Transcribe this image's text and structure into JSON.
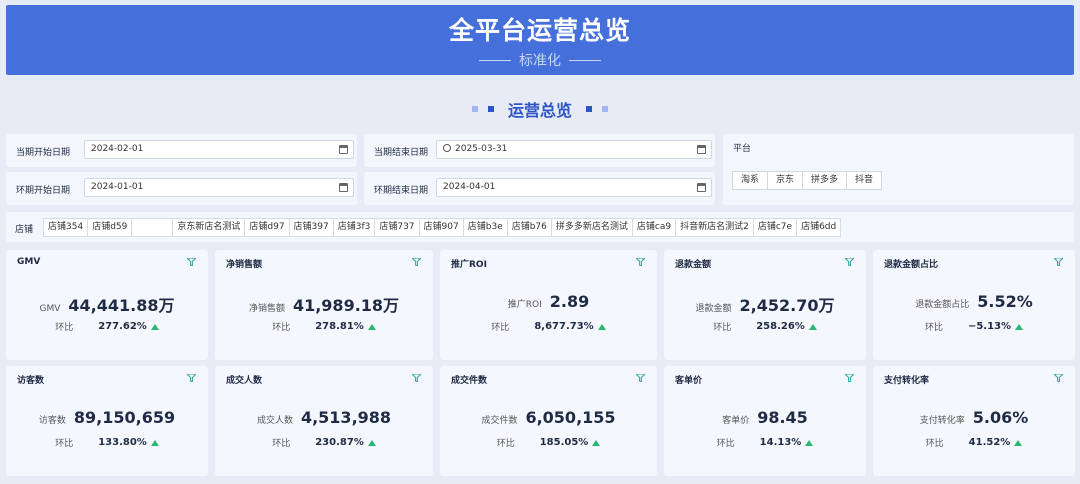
{
  "header": {
    "title": "全平台运营总览",
    "subtitle": "标准化"
  },
  "section": {
    "title": "运营总览"
  },
  "filters": {
    "cur_start_label": "当期开始日期",
    "cur_start_value": "2024-02-01",
    "cur_end_label": "当期结束日期",
    "cur_end_value": "2025-03-31",
    "prev_start_label": "环期开始日期",
    "prev_start_value": "2024-01-01",
    "prev_end_label": "环期结束日期",
    "prev_end_value": "2024-04-01",
    "platform_label": "平台",
    "platforms": [
      "淘系",
      "京东",
      "拼多多",
      "抖音"
    ]
  },
  "stores": {
    "label": "店铺",
    "items": [
      "店铺354",
      "店铺d59",
      "",
      "京东新店名测试",
      "店铺d97",
      "店铺397",
      "店铺3f3",
      "店铺737",
      "店铺907",
      "店铺b3e",
      "店铺b76",
      "拼多多新店名测试",
      "店铺ca9",
      "抖音新店名测试2",
      "店铺c7e",
      "店铺6dd"
    ]
  },
  "hb_label": "环比",
  "cards": [
    {
      "title": "GMV",
      "label": "GMV",
      "value": "44,441.88万",
      "pct": "277.62%"
    },
    {
      "title": "净销售额",
      "label": "净销售额",
      "value": "41,989.18万",
      "pct": "278.81%"
    },
    {
      "title": "推广ROI",
      "label": "推广ROI",
      "value": "2.89",
      "pct": "8,677.73%"
    },
    {
      "title": "退款金额",
      "label": "退款金额",
      "value": "2,452.70万",
      "pct": "258.26%"
    },
    {
      "title": "退款金额占比",
      "label": "退款金额占比",
      "value": "5.52%",
      "pct": "−5.13%"
    },
    {
      "title": "访客数",
      "label": "访客数",
      "value": "89,150,659",
      "pct": "133.80%"
    },
    {
      "title": "成交人数",
      "label": "成交人数",
      "value": "4,513,988",
      "pct": "230.87%"
    },
    {
      "title": "成交件数",
      "label": "成交件数",
      "value": "6,050,155",
      "pct": "185.05%"
    },
    {
      "title": "客单价",
      "label": "客单价",
      "value": "98.45",
      "pct": "14.13%"
    },
    {
      "title": "支付转化率",
      "label": "支付转化率",
      "value": "5.06%",
      "pct": "41.52%"
    }
  ],
  "colors": {
    "header_bg": "#4570dc",
    "accent": "#2e55c8",
    "up_arrow": "#2bb673"
  }
}
